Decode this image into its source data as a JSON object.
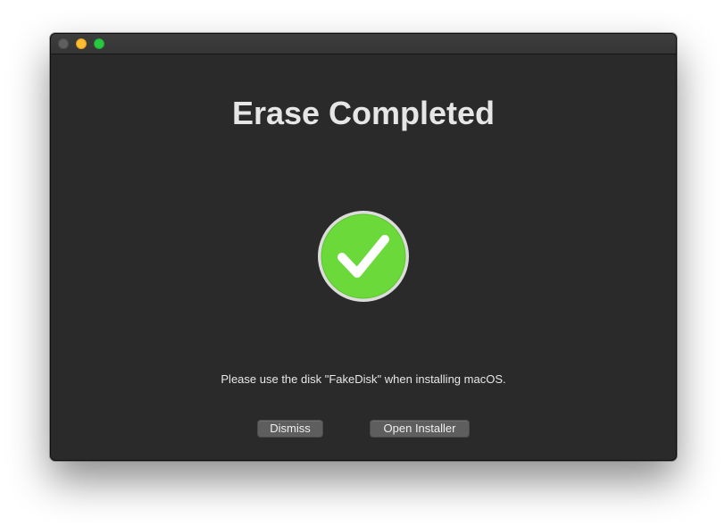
{
  "window": {
    "controls": {
      "close_icon": "close-icon",
      "minimize_icon": "minimize-icon",
      "zoom_icon": "zoom-icon"
    },
    "colors": {
      "background": "#2a2a2a",
      "close": "#5f5f5f",
      "minimize": "#febc2e",
      "zoom": "#28c840"
    }
  },
  "dialog": {
    "title": "Erase Completed",
    "status_icon": "checkmark-success-icon",
    "status_color": "#6bd93a",
    "message": "Please use the disk \"FakeDisk\" when installing macOS.",
    "buttons": {
      "dismiss_label": "Dismiss",
      "open_installer_label": "Open Installer"
    }
  }
}
